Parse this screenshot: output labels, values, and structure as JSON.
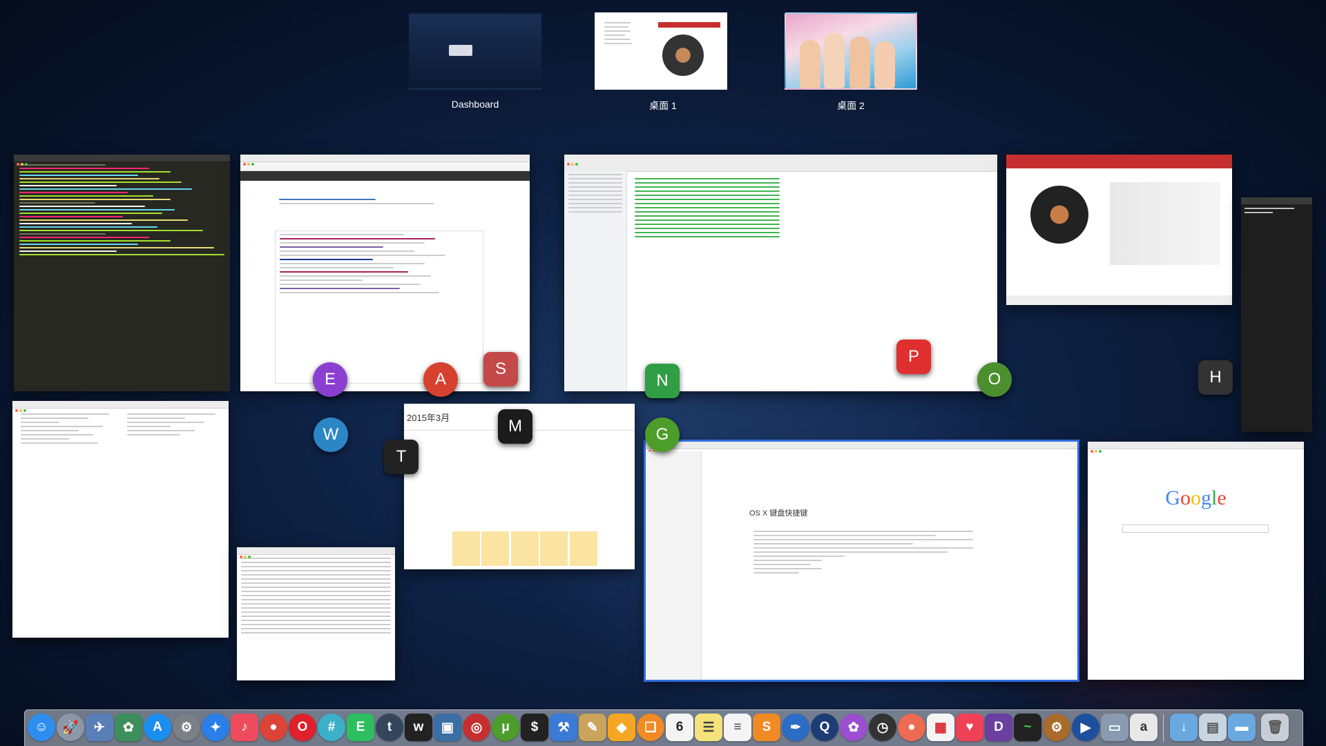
{
  "spaces": [
    {
      "label": "Dashboard"
    },
    {
      "label": "桌面 1",
      "active": true
    },
    {
      "label": "桌面 2"
    }
  ],
  "windows": {
    "calendar": {
      "month": "2015年3月"
    },
    "chrome_google": {
      "logo": "Google"
    },
    "doc_viewer": {
      "title": "OS X 键盘快捷键"
    }
  },
  "badges": [
    {
      "name": "evernote-app-badge",
      "letter": "E",
      "color": "#8b3fd1"
    },
    {
      "name": "chrome-app-badge",
      "letter": "A",
      "color": "#d6412f"
    },
    {
      "name": "sketchbook-app-badge",
      "letter": "S",
      "color": "#c44a4a"
    },
    {
      "name": "neteasemusic-app-badge",
      "letter": "N",
      "color": "#2f9e44"
    },
    {
      "name": "wps-app-badge",
      "letter": "P",
      "color": "#e02f2f"
    },
    {
      "name": "opera-app-badge",
      "letter": "O",
      "color": "#4b8f2f"
    },
    {
      "name": "terminal-app-badge",
      "letter": "H",
      "color": "#333333"
    },
    {
      "name": "wunderlist-app-badge",
      "letter": "W",
      "color": "#2b86c5"
    },
    {
      "name": "typora-app-badge",
      "letter": "T",
      "color": "#222222"
    },
    {
      "name": "mail-app-badge",
      "letter": "M",
      "color": "#1b1b1b"
    },
    {
      "name": "utorrent-app-badge",
      "letter": "G",
      "color": "#4c9d2a"
    }
  ],
  "dock": [
    {
      "name": "finder-icon",
      "glyph": "☺",
      "color": "#2d8ef0"
    },
    {
      "name": "launchpad-icon",
      "glyph": "🚀",
      "color": "#8c98a8"
    },
    {
      "name": "preview-icon",
      "glyph": "✈",
      "color": "#5a7fb8"
    },
    {
      "name": "photos-icon",
      "glyph": "✿",
      "color": "#3c8e5a"
    },
    {
      "name": "appstore-icon",
      "glyph": "A",
      "color": "#1b8ff0"
    },
    {
      "name": "system-preferences-icon",
      "glyph": "⚙",
      "color": "#7b7f86"
    },
    {
      "name": "safari-icon",
      "glyph": "✦",
      "color": "#2a7fe8"
    },
    {
      "name": "itunes-icon",
      "glyph": "♪",
      "color": "#ef4b5f"
    },
    {
      "name": "chrome-icon",
      "glyph": "●",
      "color": "#db4437"
    },
    {
      "name": "opera-icon",
      "glyph": "O",
      "color": "#e0202a"
    },
    {
      "name": "slack-icon",
      "glyph": "#",
      "color": "#3cb0c9"
    },
    {
      "name": "evernote-icon",
      "glyph": "E",
      "color": "#2dbe60"
    },
    {
      "name": "tumblr-icon",
      "glyph": "t",
      "color": "#35465c"
    },
    {
      "name": "writer-icon",
      "glyph": "w",
      "color": "#222"
    },
    {
      "name": "save-icon",
      "glyph": "▣",
      "color": "#3a6ea5"
    },
    {
      "name": "neteasemusic-icon",
      "glyph": "◎",
      "color": "#c62f2f"
    },
    {
      "name": "utorrent-icon",
      "glyph": "μ",
      "color": "#4c9d2a"
    },
    {
      "name": "terminal-icon",
      "glyph": "$",
      "color": "#222"
    },
    {
      "name": "xcode-icon",
      "glyph": "⚒",
      "color": "#3b7bd6"
    },
    {
      "name": "pencil-icon",
      "glyph": "✎",
      "color": "#caa45b"
    },
    {
      "name": "sketch-icon",
      "glyph": "◆",
      "color": "#f5a623"
    },
    {
      "name": "ibooks-icon",
      "glyph": "❑",
      "color": "#f08a24"
    },
    {
      "name": "calendar-icon",
      "glyph": "6",
      "color": "#f4f4f4"
    },
    {
      "name": "notes-icon",
      "glyph": "☰",
      "color": "#f6e27a"
    },
    {
      "name": "reminders-icon",
      "glyph": "≡",
      "color": "#f4f4f4"
    },
    {
      "name": "sublime-icon",
      "glyph": "S",
      "color": "#f08a24"
    },
    {
      "name": "feather-icon",
      "glyph": "✒",
      "color": "#2b6cc4"
    },
    {
      "name": "quicktime-search-icon",
      "glyph": "Q",
      "color": "#1c3e74"
    },
    {
      "name": "flower-icon",
      "glyph": "✿",
      "color": "#9b4fd0"
    },
    {
      "name": "timer-icon",
      "glyph": "◷",
      "color": "#333"
    },
    {
      "name": "reeder-icon",
      "glyph": "●",
      "color": "#ee6a50"
    },
    {
      "name": "grid-icon",
      "glyph": "▦",
      "color": "#f4f4f4"
    },
    {
      "name": "pocket-icon",
      "glyph": "♥",
      "color": "#ef4056"
    },
    {
      "name": "dash-icon",
      "glyph": "D",
      "color": "#6a3fa0"
    },
    {
      "name": "activity-monitor-icon",
      "glyph": "~",
      "color": "#222"
    },
    {
      "name": "cog-icon",
      "glyph": "⚙",
      "color": "#a86b2a"
    },
    {
      "name": "play-icon",
      "glyph": "▶",
      "color": "#1d4f9e"
    },
    {
      "name": "screen-icon",
      "glyph": "▭",
      "color": "#8a9ab0"
    },
    {
      "name": "script-icon",
      "glyph": "a",
      "color": "#e8e8e8"
    },
    {
      "name": "downloads-icon",
      "glyph": "↓",
      "color": "#6aa8e0"
    },
    {
      "name": "documents-icon",
      "glyph": "▤",
      "color": "#c9d4e2"
    },
    {
      "name": "folder-icon",
      "glyph": "▬",
      "color": "#6aa8e0"
    },
    {
      "name": "trash-icon",
      "glyph": "🗑",
      "color": "#c9ced6"
    }
  ]
}
